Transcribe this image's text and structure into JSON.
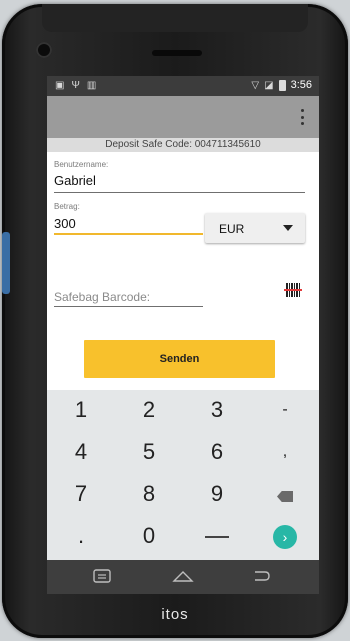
{
  "device": {
    "brand": "itos"
  },
  "status_bar": {
    "time": "3:56"
  },
  "app": {
    "deposit_code": "Deposit Safe Code: 004711345610"
  },
  "form": {
    "username": {
      "label": "Benutzername:",
      "value": "Gabriel"
    },
    "amount": {
      "label": "Betrag:",
      "value": "300"
    },
    "currency": {
      "selected": "EUR"
    },
    "barcode": {
      "placeholder": "Safebag Barcode:"
    },
    "submit_label": "Senden"
  },
  "keypad": {
    "rows": [
      [
        "1",
        "2",
        "3",
        "-"
      ],
      [
        "4",
        "5",
        "6",
        ","
      ],
      [
        "7",
        "8",
        "9",
        "backspace"
      ],
      [
        ".",
        "0",
        "space",
        "next"
      ]
    ],
    "accent_color": "#27b7a6"
  },
  "colors": {
    "accent": "#f8c12c",
    "app_bar": "#9b9b9b"
  }
}
